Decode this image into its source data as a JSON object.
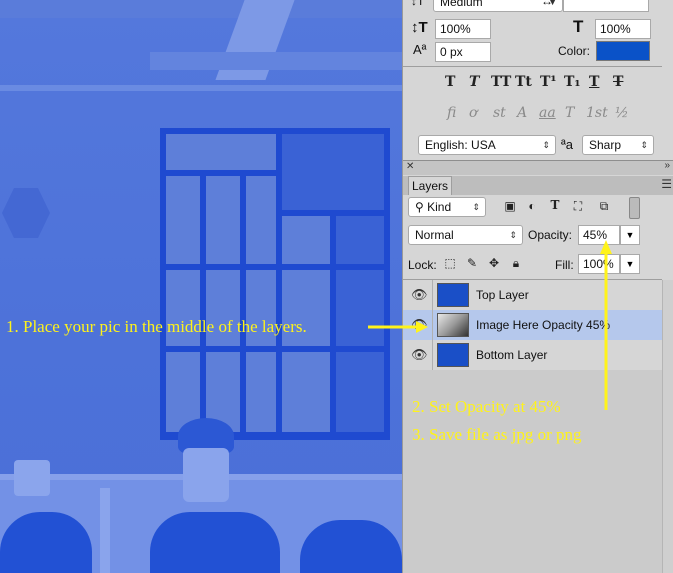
{
  "character_panel": {
    "font_style_value": "Medium",
    "vertical_scale": "100%",
    "horizontal_scale": "100%",
    "baseline_shift": "0 px",
    "color_label": "Color:",
    "color_value": "#0a52c8",
    "style_buttons": [
      "T",
      "T",
      "TT",
      "Tt",
      "T¹",
      "T₁",
      "T",
      "T"
    ],
    "opentype_buttons": [
      "fi",
      "ơ",
      "st",
      "A",
      "aa",
      "T",
      "1st",
      "½"
    ],
    "language": "English: USA",
    "aa_label": "ªa",
    "antialias": "Sharp"
  },
  "layers_panel": {
    "tab_label": "Layers",
    "filter_kind": "Kind",
    "blend_mode": "Normal",
    "opacity_label": "Opacity:",
    "opacity_value": "45%",
    "lock_label": "Lock:",
    "fill_label": "Fill:",
    "fill_value": "100%",
    "layers": [
      {
        "name": "Top Layer",
        "thumb_color": "#1a4fc7",
        "selected": false
      },
      {
        "name": "Image Here Opacity 45%",
        "thumb_color": "#cccccc",
        "selected": true
      },
      {
        "name": "Bottom Layer",
        "thumb_color": "#1a4fc7",
        "selected": false
      }
    ]
  },
  "annotations": {
    "step1": "1. Place your pic in the middle of the layers.",
    "step2": "2. Set Opacity at 45%",
    "step3": "3. Save file as jpg or png",
    "color": "#fff31a"
  },
  "icons": {
    "eye": "eye-icon",
    "search": "search-icon",
    "menu": "panel-menu-icon",
    "close": "close-icon"
  }
}
